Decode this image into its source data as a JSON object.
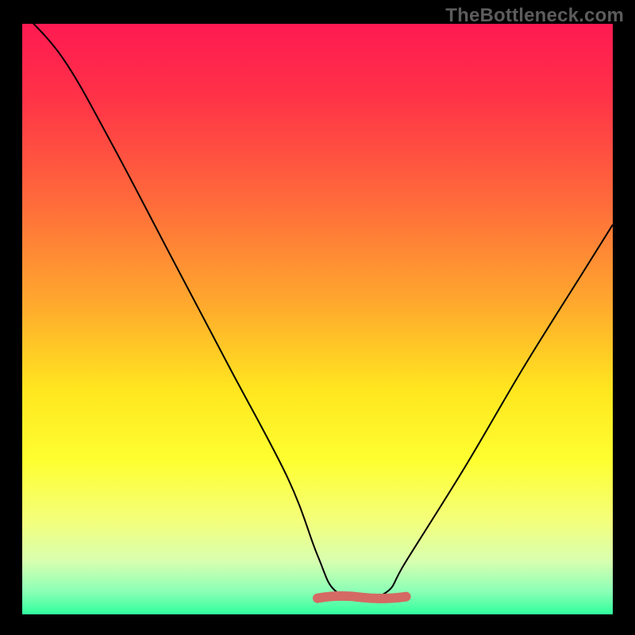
{
  "watermark": "TheBottleneck.com",
  "chart_data": {
    "type": "line",
    "title": "",
    "xlabel": "",
    "ylabel": "",
    "xlim": [
      0,
      100
    ],
    "ylim": [
      0,
      100
    ],
    "series": [
      {
        "name": "bottleneck-curve",
        "x": [
          0,
          7,
          15,
          25,
          35,
          45,
          50,
          53,
          58,
          62,
          65,
          75,
          85,
          95,
          100
        ],
        "values": [
          102,
          94,
          80,
          61,
          42,
          23,
          10,
          4,
          3,
          4,
          9,
          25,
          42,
          58,
          66
        ]
      }
    ],
    "annotations": [
      {
        "name": "valley-marker",
        "x_range": [
          50,
          65
        ],
        "y": 3,
        "color": "#d46a63"
      }
    ],
    "background_gradient_stops": [
      {
        "offset": 0.0,
        "color": "#ff1a52"
      },
      {
        "offset": 0.12,
        "color": "#ff3148"
      },
      {
        "offset": 0.3,
        "color": "#ff6a3b"
      },
      {
        "offset": 0.48,
        "color": "#ffab2d"
      },
      {
        "offset": 0.62,
        "color": "#ffe61f"
      },
      {
        "offset": 0.74,
        "color": "#feff30"
      },
      {
        "offset": 0.84,
        "color": "#f4ff7a"
      },
      {
        "offset": 0.91,
        "color": "#d8ffb0"
      },
      {
        "offset": 0.96,
        "color": "#8dffb6"
      },
      {
        "offset": 1.0,
        "color": "#30ff9e"
      }
    ]
  }
}
